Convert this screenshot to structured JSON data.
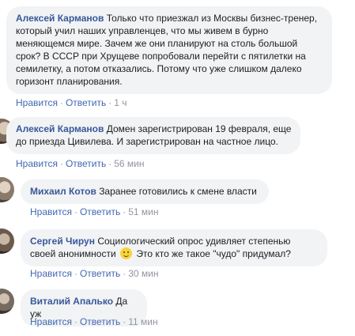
{
  "actions": {
    "like": "Нравится",
    "reply": "Ответить",
    "separator": "·"
  },
  "comments": [
    {
      "author": "Алексей Карманов",
      "text": "Только что приезжал из Москвы бизнес-тренер, который учил наших управленцев, что мы живем в бурно меняющемся мире. Зачем же они планируют на столь большой срок? В СССР при Хрущеве попробовали перейти с пятилетки на семилетку, а потом отказались. Потому что уже слишком далеко горизонт планирования.",
      "time": "1 ч"
    },
    {
      "author": "Алексей Карманов",
      "text": "Домен зарегистрирован 19 февраля, еще до приезда Цивилева. И зарегистрирован на частное лицо.",
      "time": "56 мин"
    },
    {
      "author": "Михаил Котов",
      "text": "Заранее готовились к смене власти",
      "time": "51 мин"
    },
    {
      "author": "Сергей Чирун",
      "text_before_emoji": "Социологический опрос удивляет степенью своей анонимности",
      "emoji": "smiley",
      "text_after_emoji": " Это кто же такое \"чудо\" придумал?",
      "time": "30 мин"
    },
    {
      "author": "Виталий Апалько",
      "text": "Да уж",
      "time": "11 мин"
    }
  ]
}
